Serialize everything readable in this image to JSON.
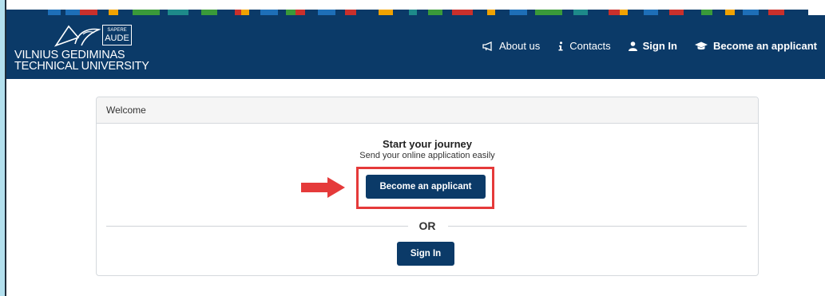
{
  "brand": {
    "motto_small": "SAPERE",
    "motto_big": "AUDE",
    "name_line1": "VILNIUS GEDIMINAS",
    "name_line2": "TECHNICAL UNIVERSITY"
  },
  "nav": {
    "items": [
      {
        "label": "About us",
        "icon": "megaphone-icon"
      },
      {
        "label": "Contacts",
        "icon": "info-icon"
      },
      {
        "label": "Sign In",
        "icon": "user-icon"
      },
      {
        "label": "Become an applicant",
        "icon": "graduation-cap-icon"
      }
    ]
  },
  "welcome": {
    "header": "Welcome",
    "title": "Start your journey",
    "subtitle": "Send your online application easily",
    "become_applicant_button": "Become an applicant",
    "or_label": "OR",
    "sign_in_button": "Sign In"
  },
  "colors": {
    "header_bg": "#0b3a68",
    "button_bg": "#0b3a68",
    "highlight": "#e53a3a",
    "page_bg": "#b3e0ee"
  }
}
